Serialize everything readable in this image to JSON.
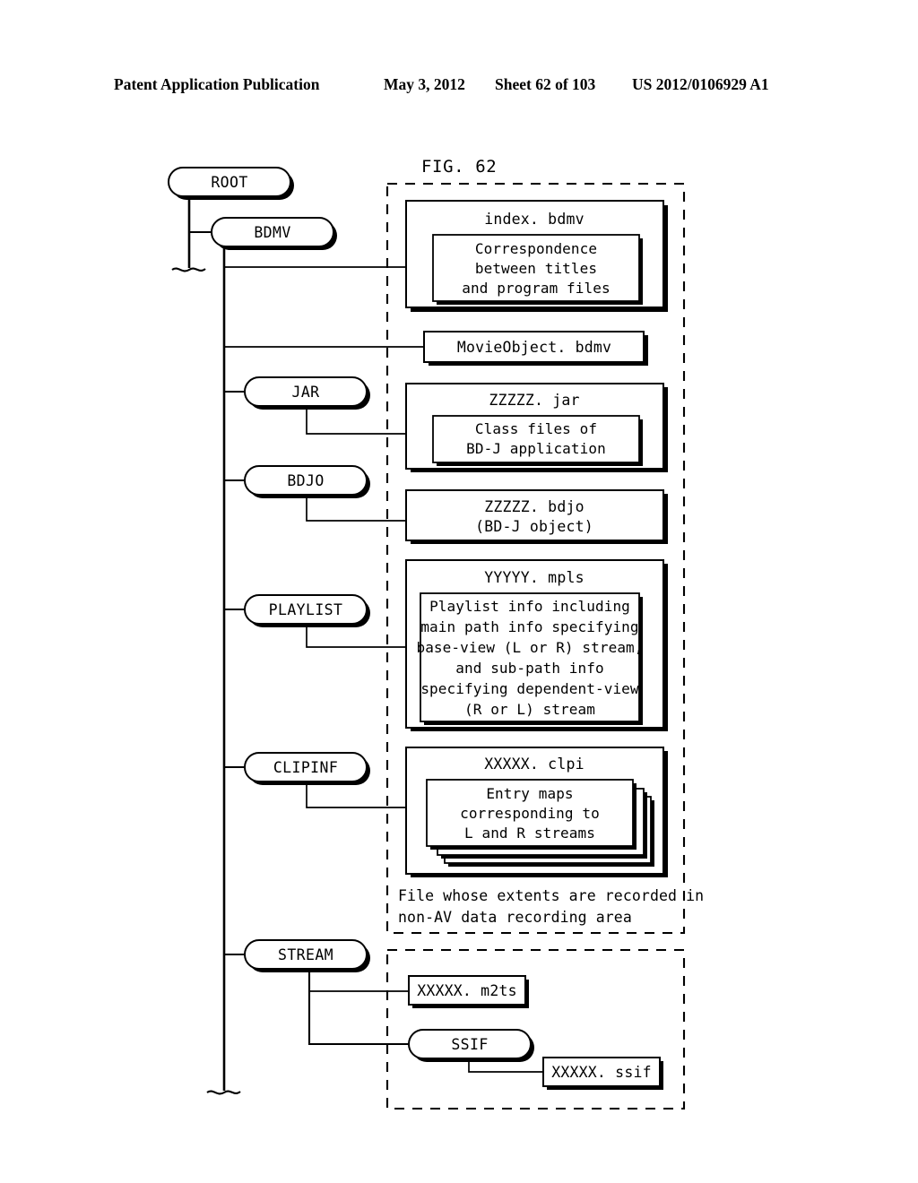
{
  "header": {
    "publication": "Patent Application Publication",
    "date": "May 3, 2012",
    "sheet": "Sheet 62 of 103",
    "number": "US 2012/0106929 A1"
  },
  "figure": {
    "label": "FIG. 62",
    "caption_line1": "File whose extents are recorded in",
    "caption_line2": "non-AV data recording area"
  },
  "tree": {
    "root": "ROOT",
    "bdmv": "BDMV",
    "jar": "JAR",
    "bdjo": "BDJO",
    "playlist": "PLAYLIST",
    "clipinf": "CLIPINF",
    "stream": "STREAM",
    "ssif": "SSIF"
  },
  "files": {
    "index": {
      "name": "index. bdmv",
      "body_line1": "Correspondence",
      "body_line2": "between titles",
      "body_line3": "and program files"
    },
    "movieobject": {
      "name": "MovieObject. bdmv"
    },
    "jar": {
      "name": "ZZZZZ. jar",
      "body_line1": "Class files of",
      "body_line2": "BD-J application"
    },
    "bdjo": {
      "name_line1": "ZZZZZ. bdjo",
      "name_line2": "(BD-J object)"
    },
    "mpls": {
      "name": "YYYYY. mpls",
      "body_line1": "Playlist info including",
      "body_line2": "main path info specifying",
      "body_line3": "base-view (L or R) stream,",
      "body_line4": "and sub-path info",
      "body_line5": "specifying dependent-view",
      "body_line6": "(R or L) stream"
    },
    "clpi": {
      "name": "XXXXX. clpi",
      "body_line1": "Entry maps",
      "body_line2": "corresponding to",
      "body_line3": "L and R streams"
    },
    "m2ts": {
      "name": "XXXXX. m2ts"
    },
    "ssif": {
      "name": "XXXXX. ssif"
    }
  },
  "colors": {
    "ink": "#000000",
    "paper": "#ffffff"
  }
}
